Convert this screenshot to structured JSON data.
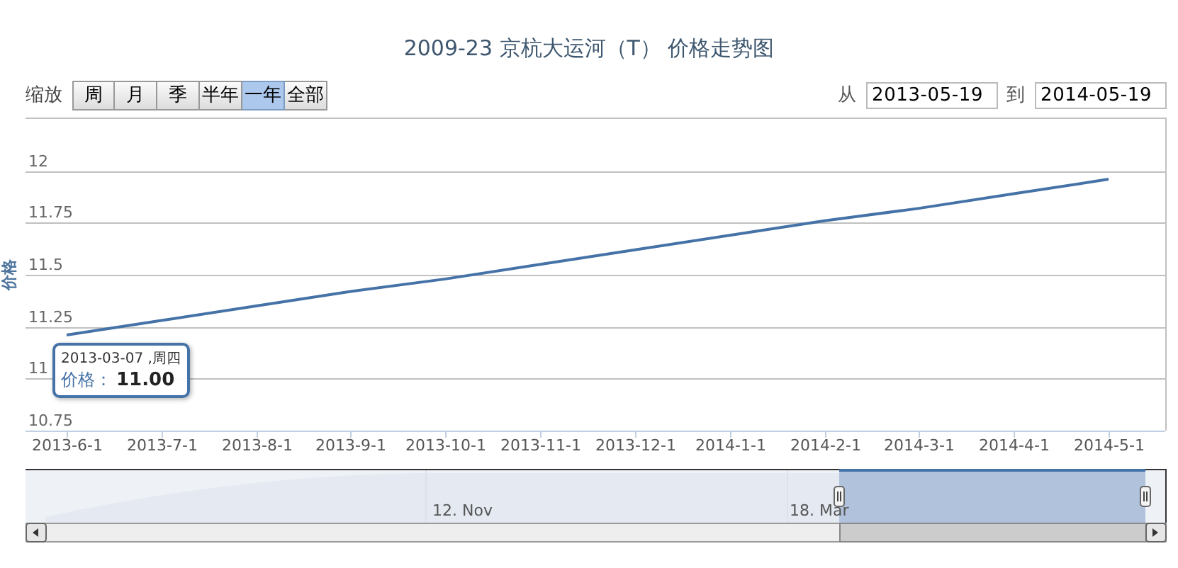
{
  "title": "2009-23 京杭大运河（T） 价格走势图",
  "zoom": {
    "label": "缩放",
    "buttons": [
      {
        "label": "周",
        "selected": false
      },
      {
        "label": "月",
        "selected": false
      },
      {
        "label": "季",
        "selected": false
      },
      {
        "label": "半年",
        "selected": false
      },
      {
        "label": "一年",
        "selected": true
      },
      {
        "label": "全部",
        "selected": false
      }
    ]
  },
  "range": {
    "from_label": "从",
    "from": "2013-05-19",
    "to_label": "到",
    "to": "2014-05-19"
  },
  "chart": {
    "chart_data": {
      "type": "line",
      "ylabel": "价格",
      "ylim": [
        10.75,
        12.25
      ],
      "grid": true,
      "categories": [
        "2013-6-1",
        "2013-7-1",
        "2013-8-1",
        "2013-9-1",
        "2013-10-1",
        "2013-11-1",
        "2013-12-1",
        "2014-1-1",
        "2014-2-1",
        "2014-3-1",
        "2014-4-1",
        "2014-5-1"
      ],
      "series": [
        {
          "color": "#4572a7",
          "values": [
            11.21,
            11.28,
            11.35,
            11.42,
            11.48,
            11.55,
            11.62,
            11.69,
            11.76,
            11.82,
            11.89,
            11.96
          ]
        }
      ],
      "yticks": [
        10.75,
        11,
        11.25,
        11.5,
        11.75,
        12
      ]
    },
    "tooltip": {
      "date": "2013-03-07 ,周四",
      "label": "价格：",
      "value": "11.00"
    },
    "navigator": {
      "labels": [
        "12. Nov",
        "18. Mar"
      ]
    }
  }
}
